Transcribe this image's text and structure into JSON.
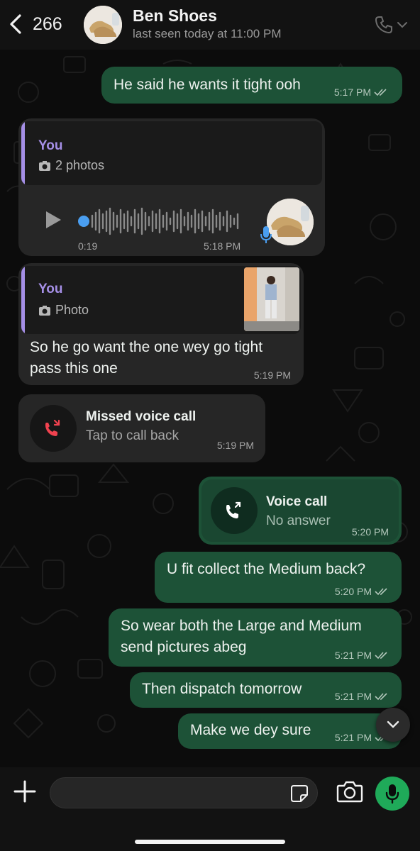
{
  "header": {
    "back_count": "266",
    "contact_name": "Ben Shoes",
    "status": "last seen today at 11:00 PM"
  },
  "messages": [
    {
      "dir": "out",
      "type": "text",
      "text": "He said he wants it tight ooh",
      "time": "5:17 PM",
      "ticks": "read"
    },
    {
      "dir": "in",
      "type": "voice_reply",
      "quote_author": "You",
      "quote_text": "2 photos",
      "duration": "0:19",
      "time": "5:18 PM"
    },
    {
      "dir": "in",
      "type": "text_reply",
      "quote_author": "You",
      "quote_text": "Photo",
      "text": "So he go want the one wey go tight pass this one",
      "time": "5:19 PM"
    },
    {
      "dir": "in",
      "type": "call",
      "title": "Missed voice call",
      "subtitle": "Tap to call back",
      "time": "5:19 PM"
    },
    {
      "dir": "out",
      "type": "call",
      "title": "Voice call",
      "subtitle": "No answer",
      "time": "5:20 PM"
    },
    {
      "dir": "out",
      "type": "text",
      "text": "U fit collect the Medium back?",
      "time": "5:20 PM",
      "ticks": "read"
    },
    {
      "dir": "out",
      "type": "text",
      "text": "So wear both the Large and Medium send pictures abeg",
      "time": "5:21 PM",
      "ticks": "read"
    },
    {
      "dir": "out",
      "type": "text",
      "text": "Then dispatch tomorrow",
      "time": "5:21 PM",
      "ticks": "read"
    },
    {
      "dir": "out",
      "type": "text",
      "text": "Make we dey sure",
      "time": "5:21 PM",
      "ticks": "read"
    }
  ],
  "composer": {
    "placeholder": ""
  },
  "icons": {
    "back": "chevron-left-icon",
    "call": "phone-icon",
    "attach": "plus-icon",
    "sticker": "sticker-icon",
    "camera": "camera-icon",
    "mic": "microphone-icon",
    "scroll": "chevron-down-icon"
  },
  "colors": {
    "outgoing_bubble": "#1d5237",
    "incoming_bubble": "#262626",
    "quote_accent": "#a58fe6",
    "missed_call_red": "#f0424f",
    "mic_green": "#1faa59"
  }
}
